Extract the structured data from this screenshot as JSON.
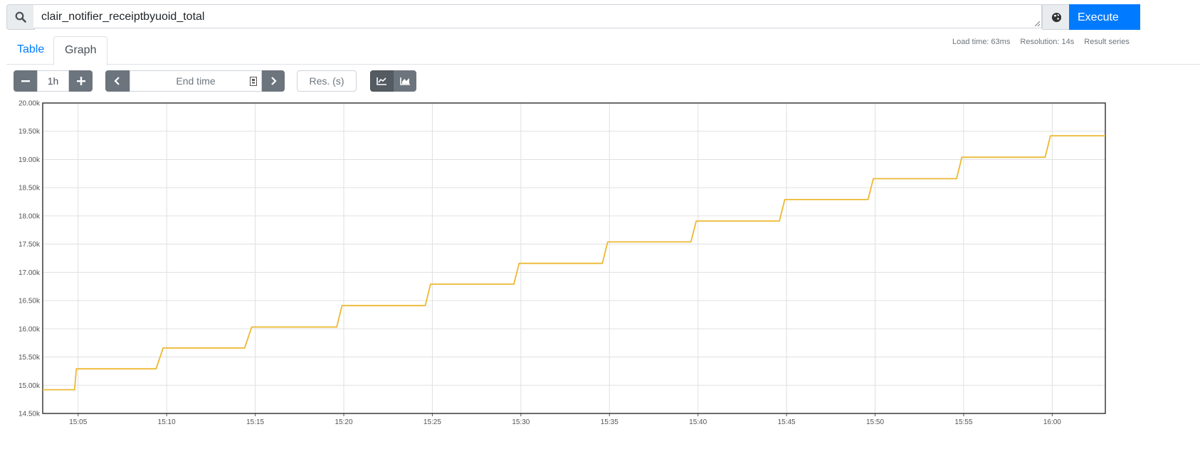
{
  "query": {
    "expression": "clair_notifier_receiptbyuoid_total"
  },
  "toolbar": {
    "execute_label": "Execute"
  },
  "stats": {
    "load_time": "Load time: 63ms",
    "resolution": "Resolution: 14s",
    "result_series": "Result series"
  },
  "tabs": [
    {
      "label": "Table"
    },
    {
      "label": "Graph"
    }
  ],
  "controls": {
    "range": "1h",
    "end_time_placeholder": "End time",
    "res_placeholder": "Res. (s)"
  },
  "colors": {
    "series": "#edb832",
    "accent": "#007bff"
  },
  "chart_data": {
    "type": "line",
    "step": true,
    "grid": true,
    "title": "",
    "xlabel": "",
    "ylabel": "",
    "xlim": [
      "15:03",
      "16:03"
    ],
    "ylim": [
      14500,
      20000
    ],
    "x_ticks": [
      "15:05",
      "15:10",
      "15:15",
      "15:20",
      "15:25",
      "15:30",
      "15:35",
      "15:40",
      "15:45",
      "15:50",
      "15:55",
      "16:00"
    ],
    "y_ticks": [
      "14.50k",
      "15.00k",
      "15.50k",
      "16.00k",
      "16.50k",
      "17.00k",
      "17.50k",
      "18.00k",
      "18.50k",
      "19.00k",
      "19.50k",
      "20.00k"
    ],
    "series": [
      {
        "name": "",
        "color": "#edb832",
        "x": [
          "15:03",
          "15:04.8",
          "15:04.9",
          "15:09.4",
          "15:09.8",
          "15:14.4",
          "15:14.8",
          "15:19.6",
          "15:19.9",
          "15:24.6",
          "15:24.9",
          "15:29.6",
          "15:29.9",
          "15:34.6",
          "15:34.9",
          "15:39.6",
          "15:39.9",
          "15:44.6",
          "15:44.9",
          "15:49.6",
          "15:49.9",
          "15:54.6",
          "15:54.9",
          "15:59.6",
          "15:59.9",
          "16:03"
        ],
        "values": [
          14920,
          14920,
          15290,
          15290,
          15660,
          15660,
          16030,
          16030,
          16410,
          16410,
          16790,
          16790,
          17160,
          17160,
          17540,
          17540,
          17910,
          17910,
          18290,
          18290,
          18660,
          18660,
          19040,
          19040,
          19420,
          19420
        ]
      }
    ]
  }
}
